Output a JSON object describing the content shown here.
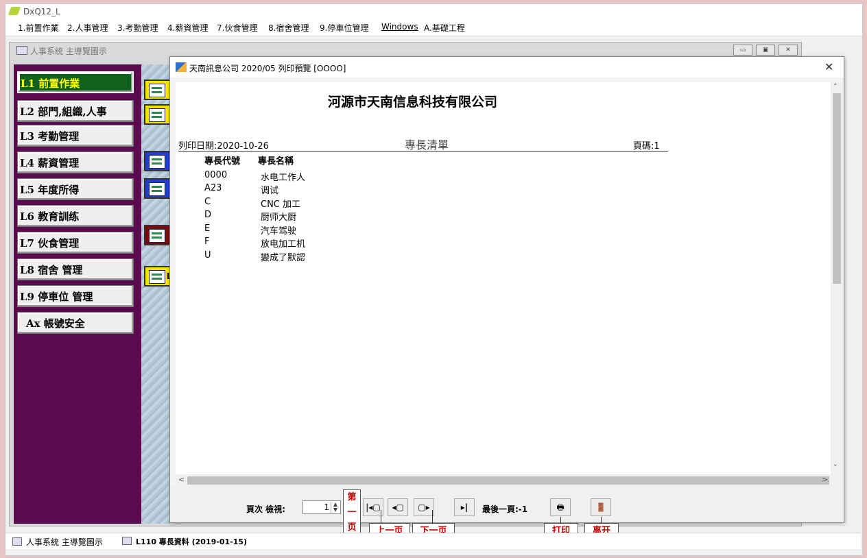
{
  "app": {
    "title": "DxQ12_L"
  },
  "menubar": [
    "1.前置作業",
    "2.人事管理",
    "3.考勤管理",
    "4.薪資管理",
    "7.伙食管理",
    "8.宿舍管理",
    "9.停車位管理",
    "Windows",
    "A.基礎工程"
  ],
  "mdi": {
    "title": "人事系统 主導覽圖示",
    "buttons": [
      "▭",
      "▣",
      "✕"
    ]
  },
  "nav": [
    "L1  前置作業",
    "L2  部門,組織,人事",
    "L3  考勤管理",
    "L4  薪資管理",
    "L5  年度所得",
    "L6  教育訓练",
    "L7  伙食管理",
    "L8  宿舍 管理",
    "L9  停車位 管理",
    "Ax  帳號安全"
  ],
  "tiles": [
    {
      "color": "#f4e200",
      "label": "I"
    },
    {
      "color": "#f4e200",
      "label": "I"
    },
    {
      "color": "#1f3fd3",
      "label": "I"
    },
    {
      "color": "#1f3fd3",
      "label": "I"
    },
    {
      "color": "#7a0a0a",
      "label": ""
    },
    {
      "color": "#f4e200",
      "label": "L"
    }
  ],
  "dialog": {
    "title": "天南訊息公司 2020/05 列印預覽 [OOOO]",
    "close": "✕",
    "report": {
      "company": "河源市天南信息科技有限公司",
      "print_date": "列印日期:2020-10-26",
      "heading": "專長清單",
      "page": "頁碼:1",
      "col_code": "專長代號",
      "col_name": "專長名稱",
      "rows": [
        {
          "code": "0000",
          "name": "水电工作人"
        },
        {
          "code": "A23",
          "name": "调试"
        },
        {
          "code": "C",
          "name": "CNC 加工"
        },
        {
          "code": "D",
          "name": "厨师大厨"
        },
        {
          "code": "E",
          "name": "汽车驾驶"
        },
        {
          "code": "F",
          "name": "放电加工机"
        },
        {
          "code": "U",
          "name": "變成了默認"
        }
      ]
    },
    "scroll": {
      "up": "˄",
      "down": "˅",
      "left": "<",
      "right": ">"
    },
    "toolbar": {
      "page_label": "頁次  檢視:",
      "page_value": "1",
      "last_page": "最後一頁:-1",
      "btn_first": "|◂▢",
      "btn_prev": "◂▢",
      "btn_next": "▢▸",
      "btn_last": "▸|",
      "btn_print": "🖶",
      "btn_exit": "🚪"
    }
  },
  "callouts": {
    "first": "第一页",
    "prev": "上一页",
    "next": "下一页",
    "print": "打印",
    "exit": "离开"
  },
  "taskbar": [
    "人事系統 主導覽圖示",
    "L110 專長資料 (2019-01-15)"
  ]
}
